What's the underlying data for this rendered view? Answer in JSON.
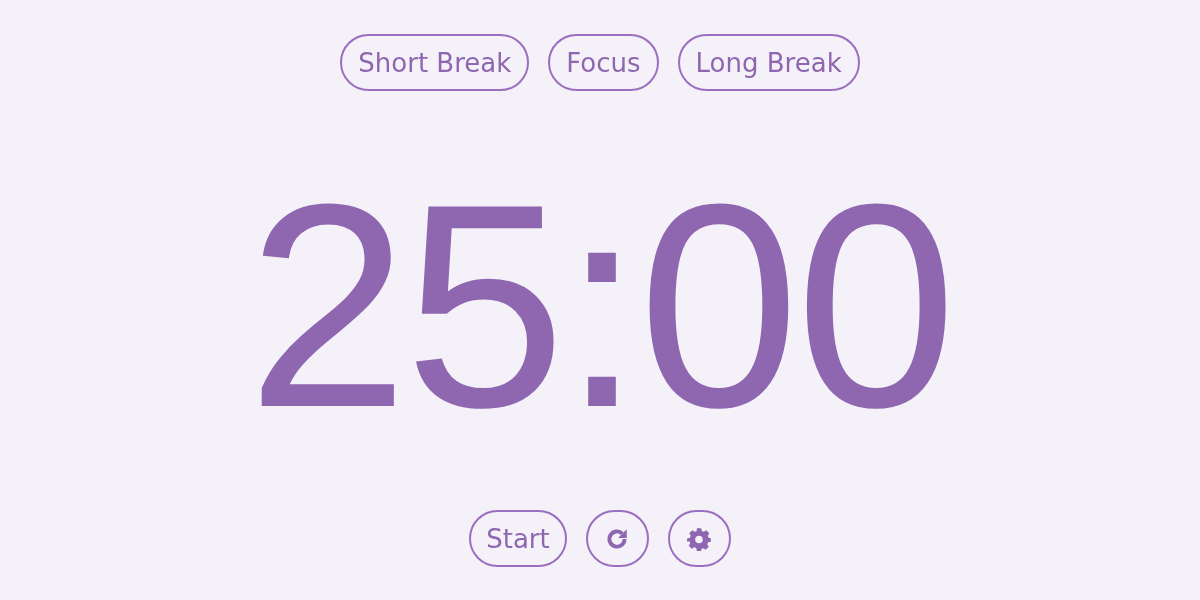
{
  "tabs": [
    {
      "label": "Short Break",
      "selected": false
    },
    {
      "label": "Focus",
      "selected": false
    },
    {
      "label": "Long Break",
      "selected": false
    }
  ],
  "timer": "25:00",
  "controls": [
    {
      "kind": "text",
      "label": "Start"
    },
    {
      "kind": "reset"
    },
    {
      "kind": "settings"
    }
  ]
}
